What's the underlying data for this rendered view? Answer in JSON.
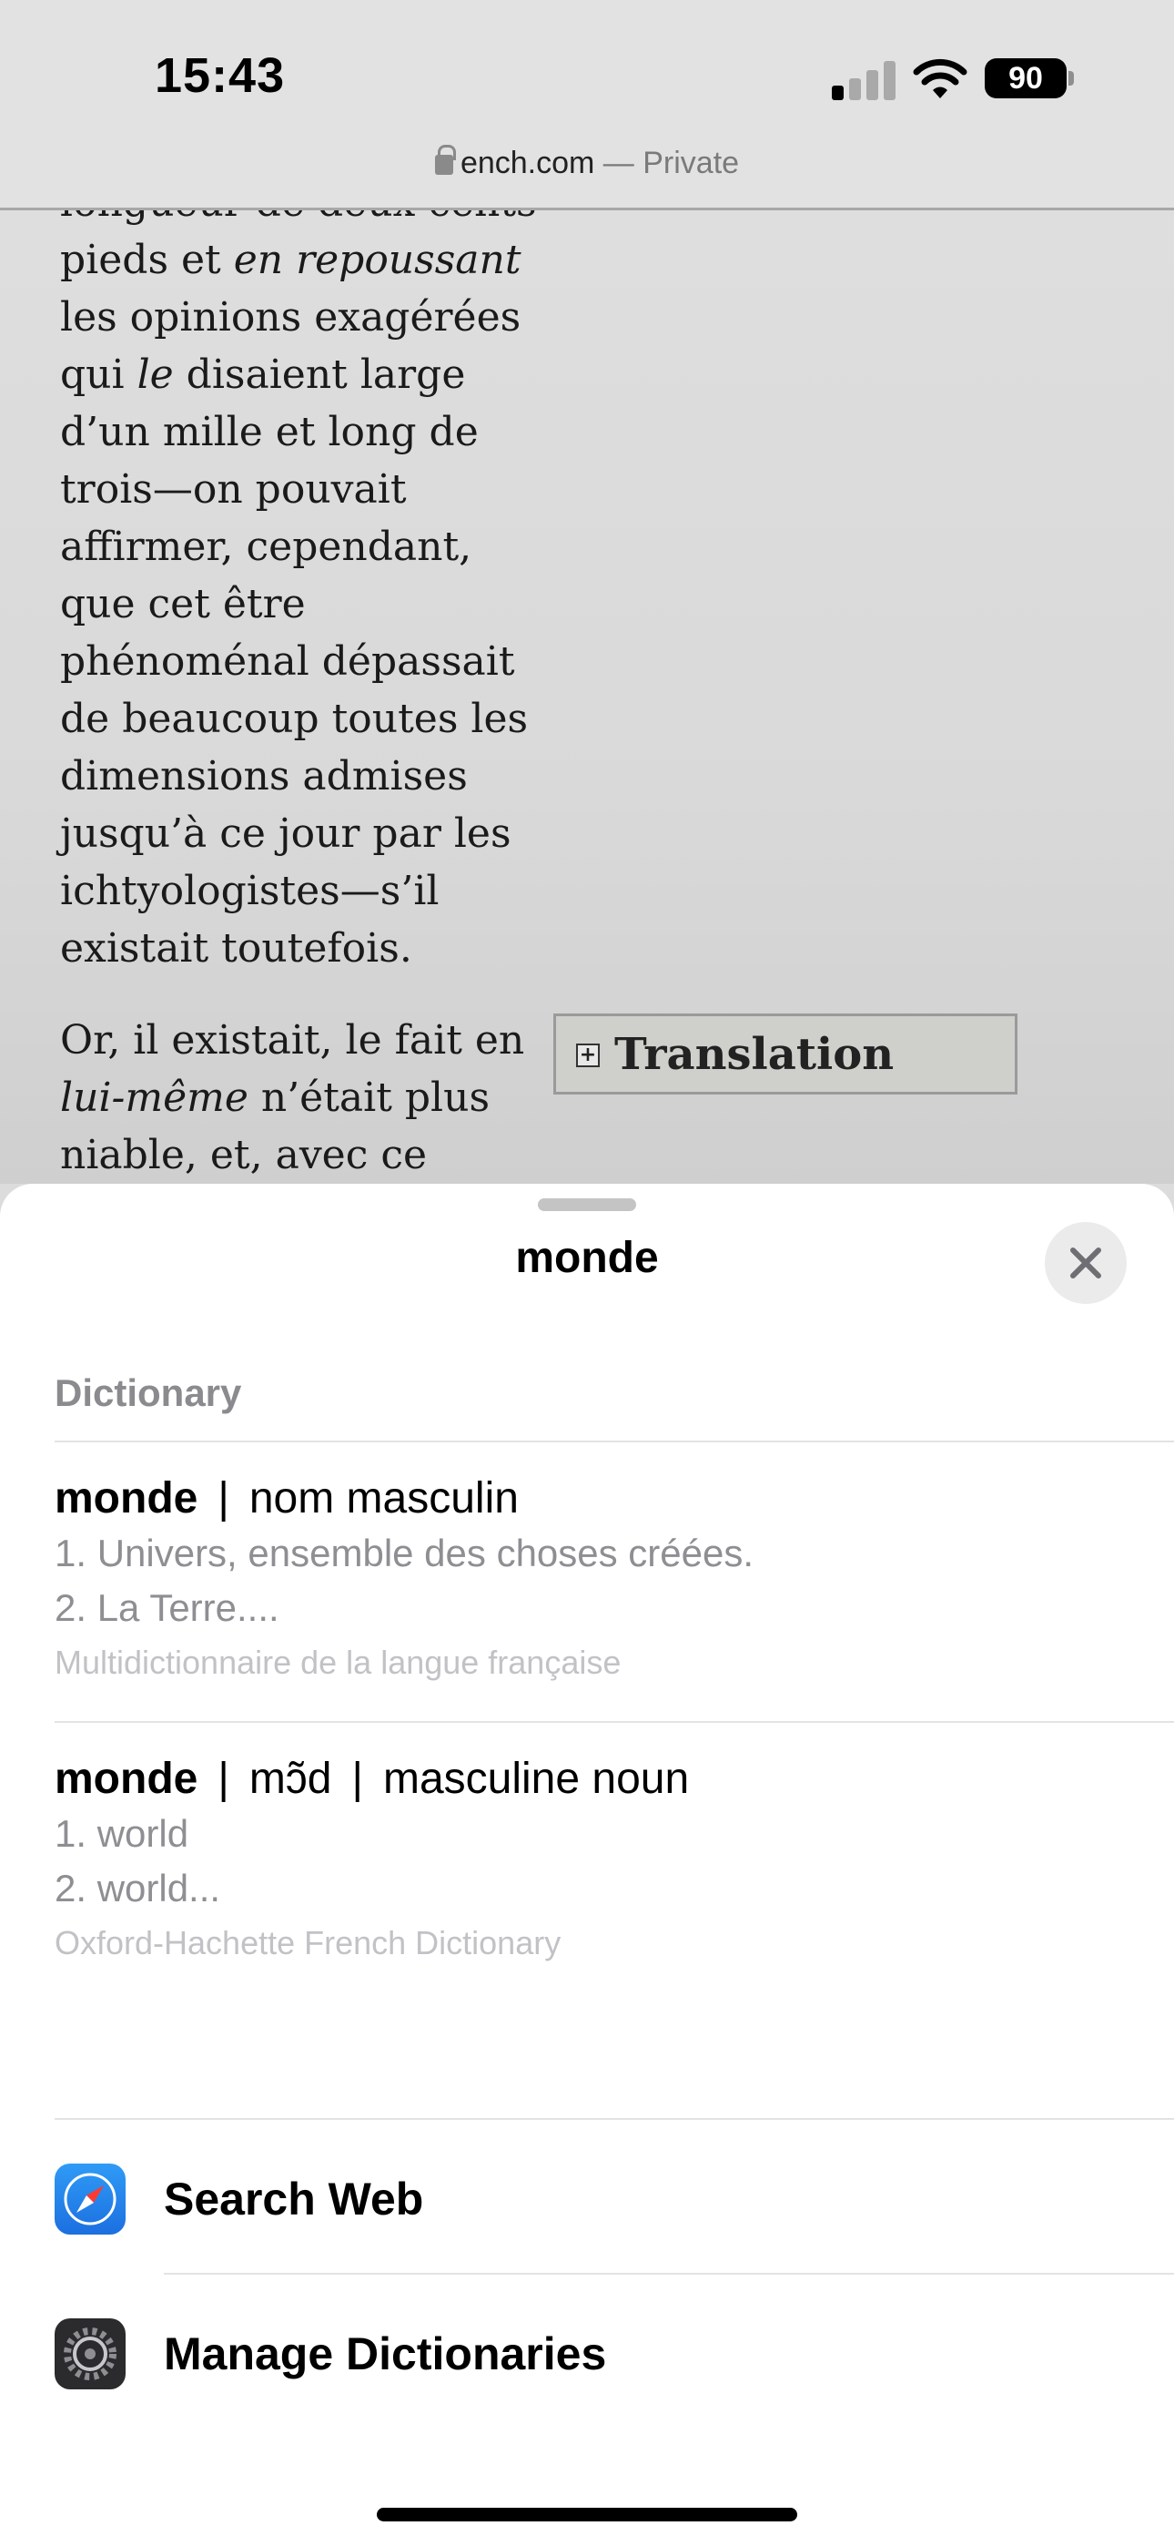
{
  "status_bar": {
    "time": "15:43",
    "battery": "90"
  },
  "url_bar": {
    "domain": "ench.com",
    "private_label": "— Private"
  },
  "article": {
    "paragraph1": [
      "longueur de deux cents",
      "pieds et |en repoussant|",
      "les opinions exagérées",
      "qui |le| disaient large",
      "d’un mille et long de",
      "trois—on pouvait",
      "affirmer, cependant,",
      "que cet être",
      "phénoménal dépassait",
      "de beaucoup toutes les",
      "dimensions admises",
      "jusqu’à ce jour par les",
      "ichtyologistes—s’il",
      "existait toutefois."
    ],
    "paragraph2": [
      "Or, il existait, le fait en",
      "|lui-même| n’était plus",
      "niable, et, avec ce"
    ],
    "translation_toggle": "Translation"
  },
  "sheet": {
    "title": "monde",
    "section_header": "Dictionary",
    "entries": [
      {
        "word": "monde",
        "grammar": "nom masculin",
        "definitions": [
          "1. Univers, ensemble des choses créées.",
          "2. La Terre...."
        ],
        "source": "Multidictionnaire de la langue française"
      },
      {
        "word": "monde",
        "pronunciation": "mɔ̃d",
        "grammar": "masculine noun",
        "definitions": [
          "1. world",
          "2. world..."
        ],
        "source": "Oxford-Hachette French Dictionary"
      }
    ],
    "actions": [
      {
        "label": "Search Web",
        "icon": "safari-icon"
      },
      {
        "label": "Manage Dictionaries",
        "icon": "settings-icon"
      }
    ]
  }
}
